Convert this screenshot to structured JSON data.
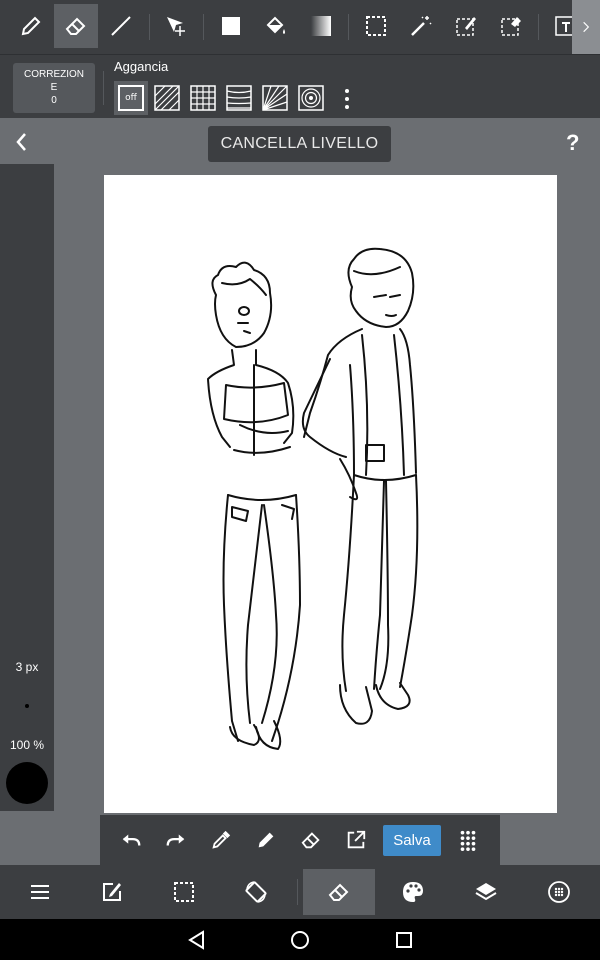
{
  "toolbar": {
    "tools": [
      {
        "name": "pen-icon",
        "active": false
      },
      {
        "name": "eraser-icon",
        "active": true
      },
      {
        "name": "line-icon",
        "active": false
      },
      {
        "name": "move-icon",
        "active": false
      },
      {
        "name": "fill-rect-icon",
        "active": false
      },
      {
        "name": "bucket-icon",
        "active": false
      },
      {
        "name": "gradient-icon",
        "active": false
      },
      {
        "name": "select-rect-icon",
        "active": false
      },
      {
        "name": "magic-wand-icon",
        "active": false
      },
      {
        "name": "select-pen-icon",
        "active": false
      },
      {
        "name": "select-eraser-icon",
        "active": false
      },
      {
        "name": "text-icon",
        "active": false
      }
    ]
  },
  "subbar": {
    "correction_label": "CORREZION\nE\n0",
    "snap_label": "Aggancia",
    "snap_off": "off"
  },
  "layer": {
    "clear_label": "CANCELLA LIVELLO",
    "help": "?"
  },
  "brush": {
    "size": "3 px",
    "opacity": "100 %",
    "color": "#000000"
  },
  "actions": {
    "save_label": "Salva"
  },
  "colors": {
    "accent": "#3f8bc9",
    "panel": "#3c3e41",
    "background": "#6b6e72"
  }
}
